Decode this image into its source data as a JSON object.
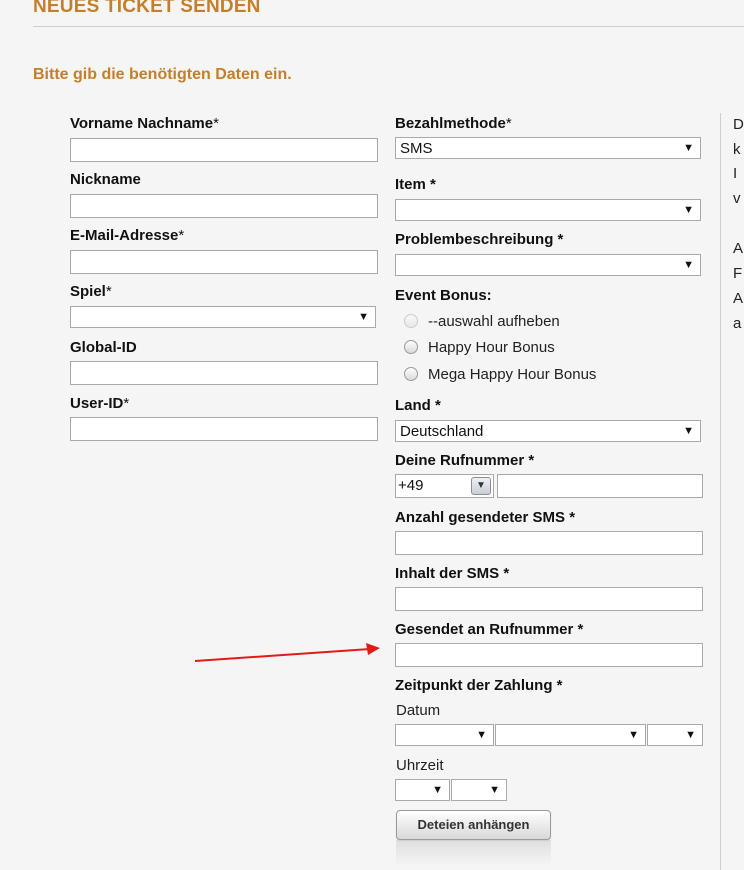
{
  "page": {
    "heading": "NEUES TICKET SENDEN",
    "subheading": "Bitte gib die benötigten Daten ein."
  },
  "left_form": {
    "name_label": "Vorname Nachname",
    "nickname_label": "Nickname",
    "email_label": "E-Mail-Adresse",
    "game_label": "Spiel",
    "global_id_label": "Global-ID",
    "user_id_label": "User-ID",
    "required_mark": "*"
  },
  "right_form": {
    "payment_label": "Bezahlmethode",
    "payment_value": "SMS",
    "item_label": "Item *",
    "problem_label": "Problembeschreibung *",
    "event_bonus_label": "Event Bonus:",
    "event_options": [
      "--auswahl aufheben",
      "Happy Hour Bonus",
      "Mega Happy Hour Bonus"
    ],
    "country_label": "Land *",
    "country_value": "Deutschland",
    "phone_label": "Deine Rufnummer *",
    "phone_prefix": "+49",
    "sms_count_label": "Anzahl gesendeter SMS *",
    "sms_content_label": "Inhalt der SMS *",
    "sent_to_label": "Gesendet an Rufnummer *",
    "payment_time_label": "Zeitpunkt der Zahlung *",
    "date_label": "Datum",
    "time_label": "Uhrzeit",
    "upload_button": "Deteien anhängen"
  },
  "side_panel": {
    "lines": [
      "D",
      "k",
      "I",
      "v",
      "",
      "A",
      "F",
      "A",
      "a"
    ]
  },
  "colors": {
    "accent": "#c47f2a",
    "arrow": "#e11a1a"
  },
  "icons": {
    "dropdown": "▼",
    "small_dropdown": "▾"
  }
}
